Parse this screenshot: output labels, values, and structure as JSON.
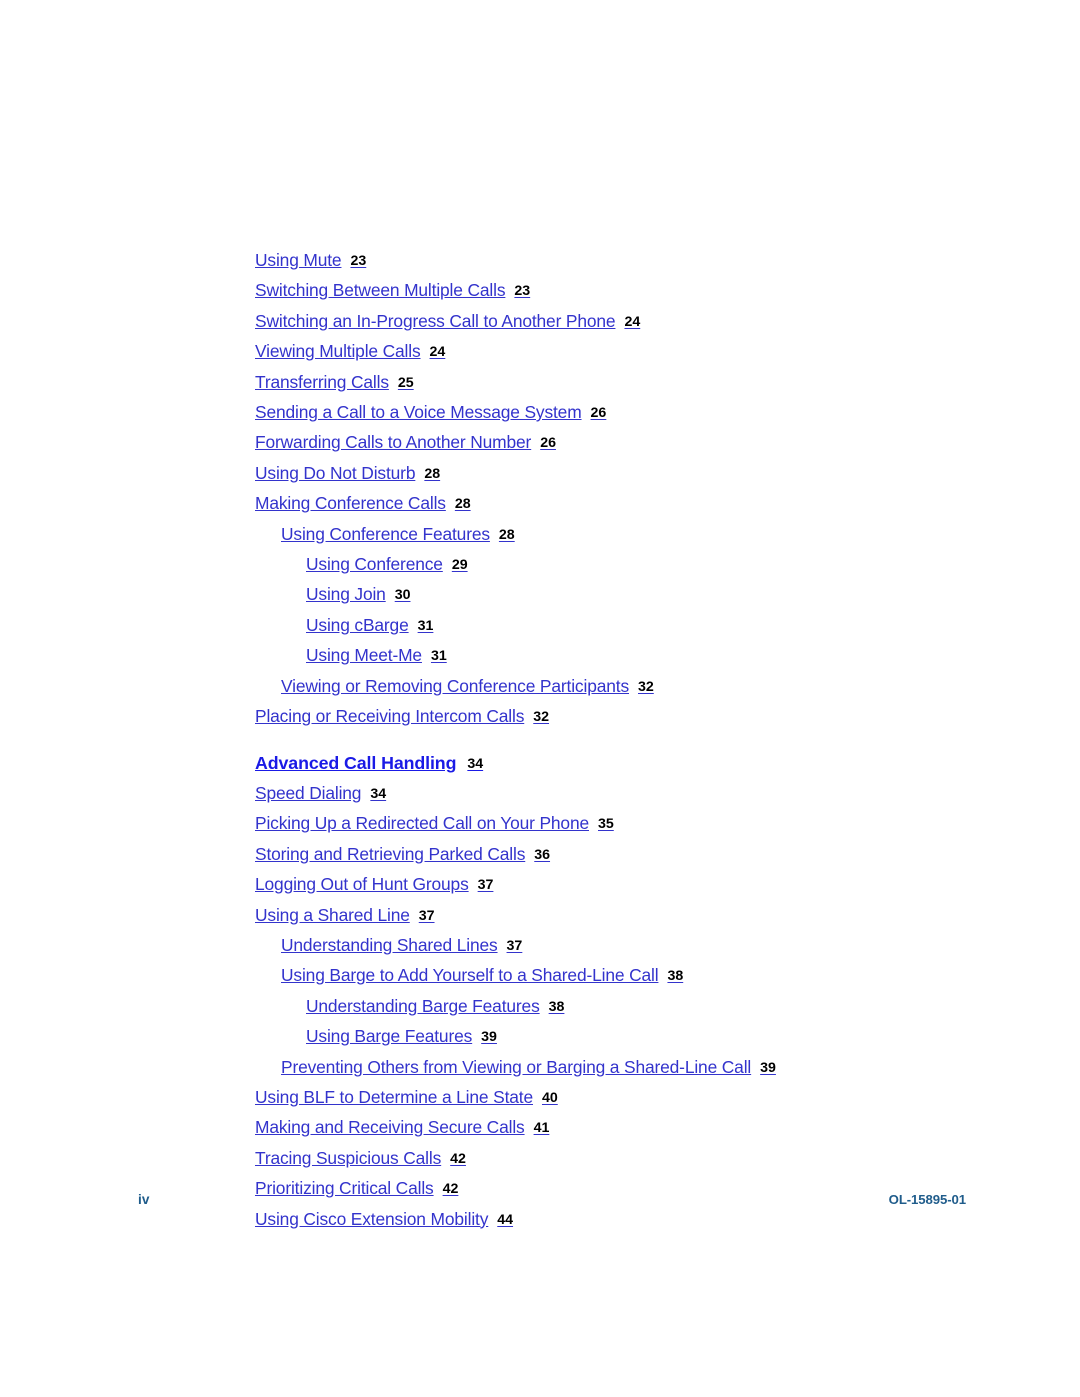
{
  "page": {
    "folio": "iv",
    "doc_id": "OL-15895-01"
  },
  "toc": {
    "entries": [
      {
        "label": "Using Mute",
        "page": "23",
        "level": 1,
        "kind": "entry"
      },
      {
        "label": "Switching Between Multiple Calls",
        "page": "23",
        "level": 1,
        "kind": "entry"
      },
      {
        "label": "Switching an In-Progress Call to Another Phone",
        "page": "24",
        "level": 1,
        "kind": "entry"
      },
      {
        "label": "Viewing Multiple Calls",
        "page": "24",
        "level": 1,
        "kind": "entry"
      },
      {
        "label": "Transferring Calls",
        "page": "25",
        "level": 1,
        "kind": "entry"
      },
      {
        "label": "Sending a Call to a Voice Message System",
        "page": "26",
        "level": 1,
        "kind": "entry"
      },
      {
        "label": "Forwarding Calls to Another Number",
        "page": "26",
        "level": 1,
        "kind": "entry"
      },
      {
        "label": "Using Do Not Disturb",
        "page": "28",
        "level": 1,
        "kind": "entry"
      },
      {
        "label": "Making Conference Calls",
        "page": "28",
        "level": 1,
        "kind": "entry"
      },
      {
        "label": "Using Conference Features",
        "page": "28",
        "level": 2,
        "kind": "entry"
      },
      {
        "label": "Using Conference",
        "page": "29",
        "level": 3,
        "kind": "entry"
      },
      {
        "label": "Using Join",
        "page": "30",
        "level": 3,
        "kind": "entry"
      },
      {
        "label": "Using cBarge",
        "page": "31",
        "level": 3,
        "kind": "entry"
      },
      {
        "label": "Using Meet-Me",
        "page": "31",
        "level": 3,
        "kind": "entry"
      },
      {
        "label": "Viewing or Removing Conference Participants",
        "page": "32",
        "level": 2,
        "kind": "entry"
      },
      {
        "label": "Placing or Receiving Intercom Calls",
        "page": "32",
        "level": 1,
        "kind": "entry"
      },
      {
        "label": "Advanced Call Handling",
        "page": "34",
        "level": 1,
        "kind": "heading"
      },
      {
        "label": "Speed Dialing",
        "page": "34",
        "level": 1,
        "kind": "entry"
      },
      {
        "label": "Picking Up a Redirected Call on Your Phone",
        "page": "35",
        "level": 1,
        "kind": "entry"
      },
      {
        "label": "Storing and Retrieving Parked Calls",
        "page": "36",
        "level": 1,
        "kind": "entry"
      },
      {
        "label": "Logging Out of Hunt Groups",
        "page": "37",
        "level": 1,
        "kind": "entry"
      },
      {
        "label": "Using a Shared Line",
        "page": "37",
        "level": 1,
        "kind": "entry"
      },
      {
        "label": "Understanding Shared Lines",
        "page": "37",
        "level": 2,
        "kind": "entry"
      },
      {
        "label": "Using Barge to Add Yourself to a Shared-Line Call",
        "page": "38",
        "level": 2,
        "kind": "entry"
      },
      {
        "label": "Understanding Barge Features",
        "page": "38",
        "level": 3,
        "kind": "entry"
      },
      {
        "label": "Using Barge Features",
        "page": "39",
        "level": 3,
        "kind": "entry"
      },
      {
        "label": "Preventing Others from Viewing or Barging a Shared-Line Call",
        "page": "39",
        "level": 2,
        "kind": "entry"
      },
      {
        "label": "Using BLF to Determine a Line State",
        "page": "40",
        "level": 1,
        "kind": "entry"
      },
      {
        "label": "Making and Receiving Secure Calls",
        "page": "41",
        "level": 1,
        "kind": "entry"
      },
      {
        "label": "Tracing Suspicious Calls",
        "page": "42",
        "level": 1,
        "kind": "entry"
      },
      {
        "label": "Prioritizing Critical Calls",
        "page": "42",
        "level": 1,
        "kind": "entry"
      },
      {
        "label": "Using Cisco Extension Mobility",
        "page": "44",
        "level": 1,
        "kind": "entry"
      }
    ]
  },
  "colors": {
    "link_blue": "#3333cc",
    "heading_blue": "#1a1ae6",
    "page_number_black": "#000000",
    "footer_blue": "#1f5c8b",
    "background": "#ffffff"
  }
}
